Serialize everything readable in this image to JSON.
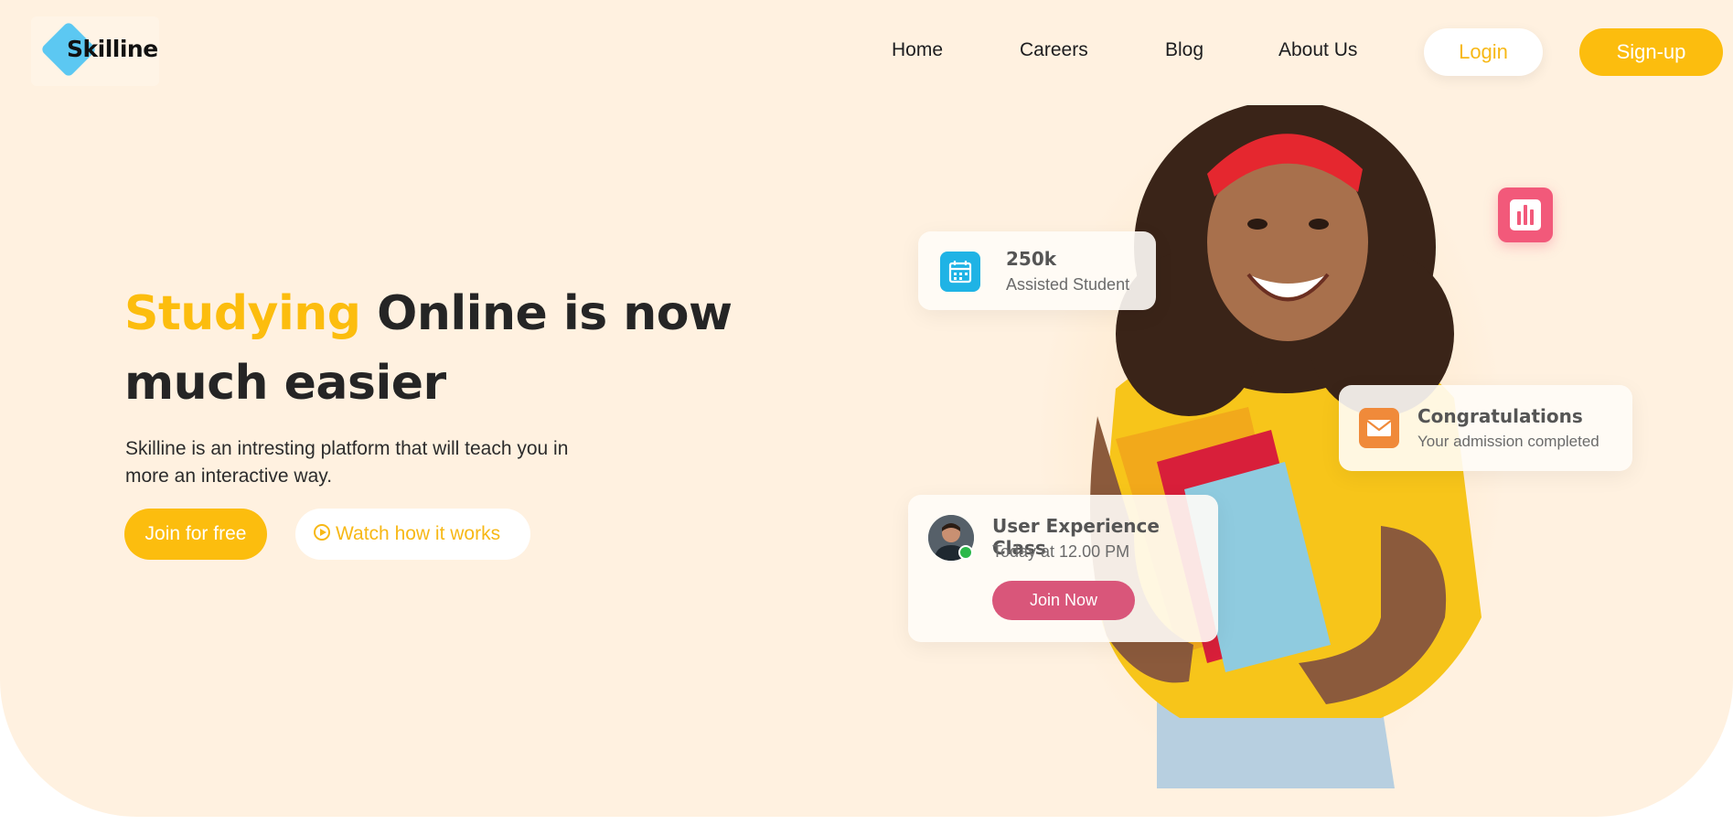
{
  "brand": {
    "name": "Skilline",
    "accent": "#fcbd0e",
    "logo_color": "#5cc8f2"
  },
  "nav": {
    "links": [
      "Home",
      "Careers",
      "Blog",
      "About Us"
    ],
    "login_label": "Login",
    "signup_label": "Sign-up"
  },
  "hero": {
    "headline_highlight": "Studying",
    "headline_rest": " Online is now much easier",
    "subtext": "Skilline is an intresting platform that will teach you in more an interactive way.",
    "join_label": "Join for free",
    "watch_label": "Watch how it works"
  },
  "cards": {
    "students": {
      "value": "250k",
      "label": "Assisted Student",
      "icon": "calendar-icon"
    },
    "congrats": {
      "title": "Congratulations",
      "subtitle": "Your admission completed",
      "icon": "mail-icon"
    },
    "class": {
      "title": "User Experience Class",
      "time": "Today at 12.00 PM",
      "button_label": "Join Now"
    },
    "stats_icon": "bar-chart-icon"
  }
}
